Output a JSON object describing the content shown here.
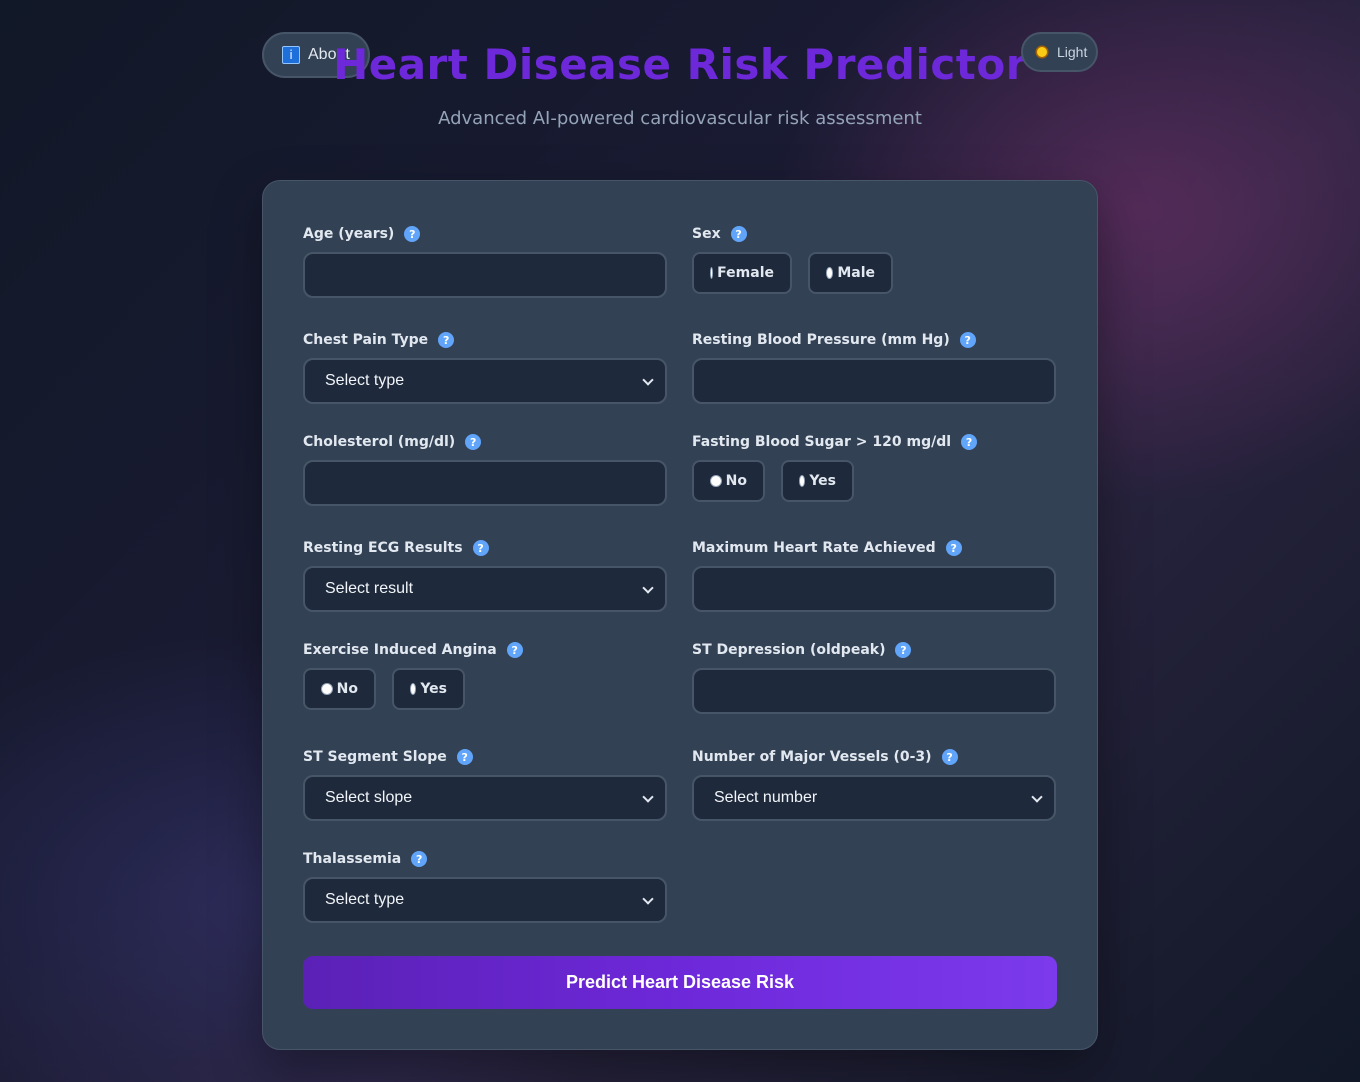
{
  "header": {
    "about_label": "About",
    "theme_label": "Light",
    "title": "Heart Disease Risk Predictor",
    "subtitle": "Advanced AI-powered cardiovascular risk assessment"
  },
  "form": {
    "age": {
      "label": "Age (years)",
      "value": ""
    },
    "sex": {
      "label": "Sex",
      "options": [
        "Female",
        "Male"
      ]
    },
    "chest_pain": {
      "label": "Chest Pain Type",
      "selected": "Select type"
    },
    "resting_bp": {
      "label": "Resting Blood Pressure (mm Hg)",
      "value": ""
    },
    "cholesterol": {
      "label": "Cholesterol (mg/dl)",
      "value": ""
    },
    "fasting_bs": {
      "label": "Fasting Blood Sugar > 120 mg/dl",
      "options": [
        "No",
        "Yes"
      ]
    },
    "resting_ecg": {
      "label": "Resting ECG Results",
      "selected": "Select result"
    },
    "max_hr": {
      "label": "Maximum Heart Rate Achieved",
      "value": ""
    },
    "exercise_angina": {
      "label": "Exercise Induced Angina",
      "options": [
        "No",
        "Yes"
      ]
    },
    "st_depression": {
      "label": "ST Depression (oldpeak)",
      "value": ""
    },
    "st_slope": {
      "label": "ST Segment Slope",
      "selected": "Select slope"
    },
    "major_vessels": {
      "label": "Number of Major Vessels (0-3)",
      "selected": "Select number"
    },
    "thalassemia": {
      "label": "Thalassemia",
      "selected": "Select type"
    },
    "submit_label": "Predict Heart Disease Risk",
    "help_glyph": "?"
  },
  "colors": {
    "accent": "#6d28d9",
    "card": "#334155",
    "input_bg": "#1e293b",
    "help_icon": "#60a5fa"
  }
}
